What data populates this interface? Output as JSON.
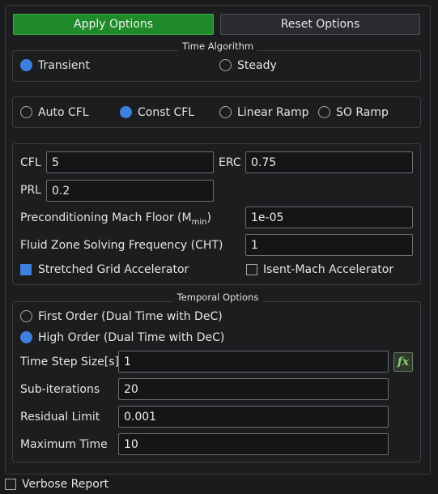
{
  "buttons": {
    "apply": "Apply Options",
    "reset": "Reset Options"
  },
  "time_algorithm": {
    "title": "Time Algorithm",
    "options": [
      {
        "label": "Transient",
        "selected": true
      },
      {
        "label": "Steady",
        "selected": false
      }
    ]
  },
  "cfl_mode": {
    "options": [
      {
        "label": "Auto CFL",
        "selected": false
      },
      {
        "label": "Const CFL",
        "selected": true
      },
      {
        "label": "Linear Ramp",
        "selected": false
      },
      {
        "label": "SO Ramp",
        "selected": false
      }
    ]
  },
  "params": {
    "cfl_label": "CFL",
    "cfl_value": "5",
    "erc_label": "ERC",
    "erc_value": "0.75",
    "prl_label": "PRL",
    "prl_value": "0.2",
    "mach_floor_label": "Preconditioning Mach Floor (M",
    "mach_floor_sub": "min",
    "mach_floor_suffix": ")",
    "mach_floor_value": "1e-05",
    "cht_label": "Fluid Zone Solving Frequency (CHT)",
    "cht_value": "1",
    "stretched_grid_label": "Stretched Grid Accelerator",
    "stretched_grid_checked": true,
    "isent_mach_label": "Isent-Mach Accelerator",
    "isent_mach_checked": false
  },
  "temporal": {
    "title": "Temporal Options",
    "first_order_label": "First Order (Dual Time with DeC)",
    "first_order_selected": false,
    "high_order_label": "High Order (Dual Time with DeC)",
    "high_order_selected": true,
    "time_step_label": "Time Step Size[s]",
    "time_step_value": "1",
    "fx_icon": "fx",
    "subiter_label": "Sub-iterations",
    "subiter_value": "20",
    "residual_label": "Residual Limit",
    "residual_value": "0.001",
    "max_time_label": "Maximum Time",
    "max_time_value": "10"
  },
  "verbose": {
    "label": "Verbose Report",
    "checked": false
  },
  "colors": {
    "accent": "#3f7fe0",
    "apply_bg": "#1f8a2a",
    "background": "#1c1d1f"
  }
}
